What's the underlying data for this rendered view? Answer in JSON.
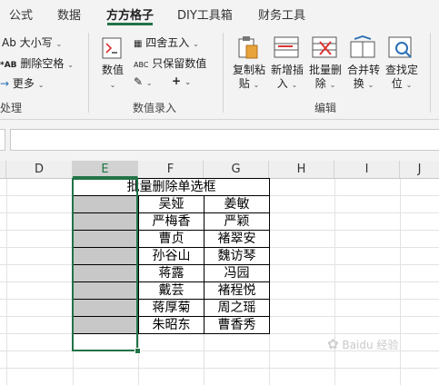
{
  "tabs": [
    "公式",
    "数据",
    "方方格子",
    "DIY工具箱",
    "财务工具"
  ],
  "ribbon": {
    "case_btn": "Ab 大小写",
    "del_space_btn": "删除空格",
    "more_btn": "更多",
    "text_group_label": "处理",
    "numeric_btn": "数值",
    "round_btn": "四舍五入",
    "keep_num_btn": "只保留数值",
    "plus_btn": "+",
    "numeric_group_label": "数值录入",
    "copy_paste_btn": [
      "复制粘",
      "贴"
    ],
    "insert_btn": [
      "新增插",
      "入"
    ],
    "batch_delete_btn": [
      "批量删",
      "除"
    ],
    "merge_btn": [
      "合并转",
      "换"
    ],
    "find_btn": [
      "查找定",
      "位"
    ],
    "edit_group_label": "编辑"
  },
  "columns": [
    "D",
    "E",
    "F",
    "G",
    "H",
    "I",
    "J"
  ],
  "sheet": {
    "title": "批量删除单选框",
    "names_f": [
      "吴娅",
      "严梅香",
      "曹贞",
      "孙谷山",
      "蒋露",
      "戴芸",
      "蒋厚菊",
      "朱昭东"
    ],
    "names_g": [
      "姜敏",
      "严颖",
      "褚翠安",
      "魏访琴",
      "冯园",
      "褚程悦",
      "周之瑶",
      "曹香秀"
    ]
  },
  "watermark": "Baidu 经验"
}
